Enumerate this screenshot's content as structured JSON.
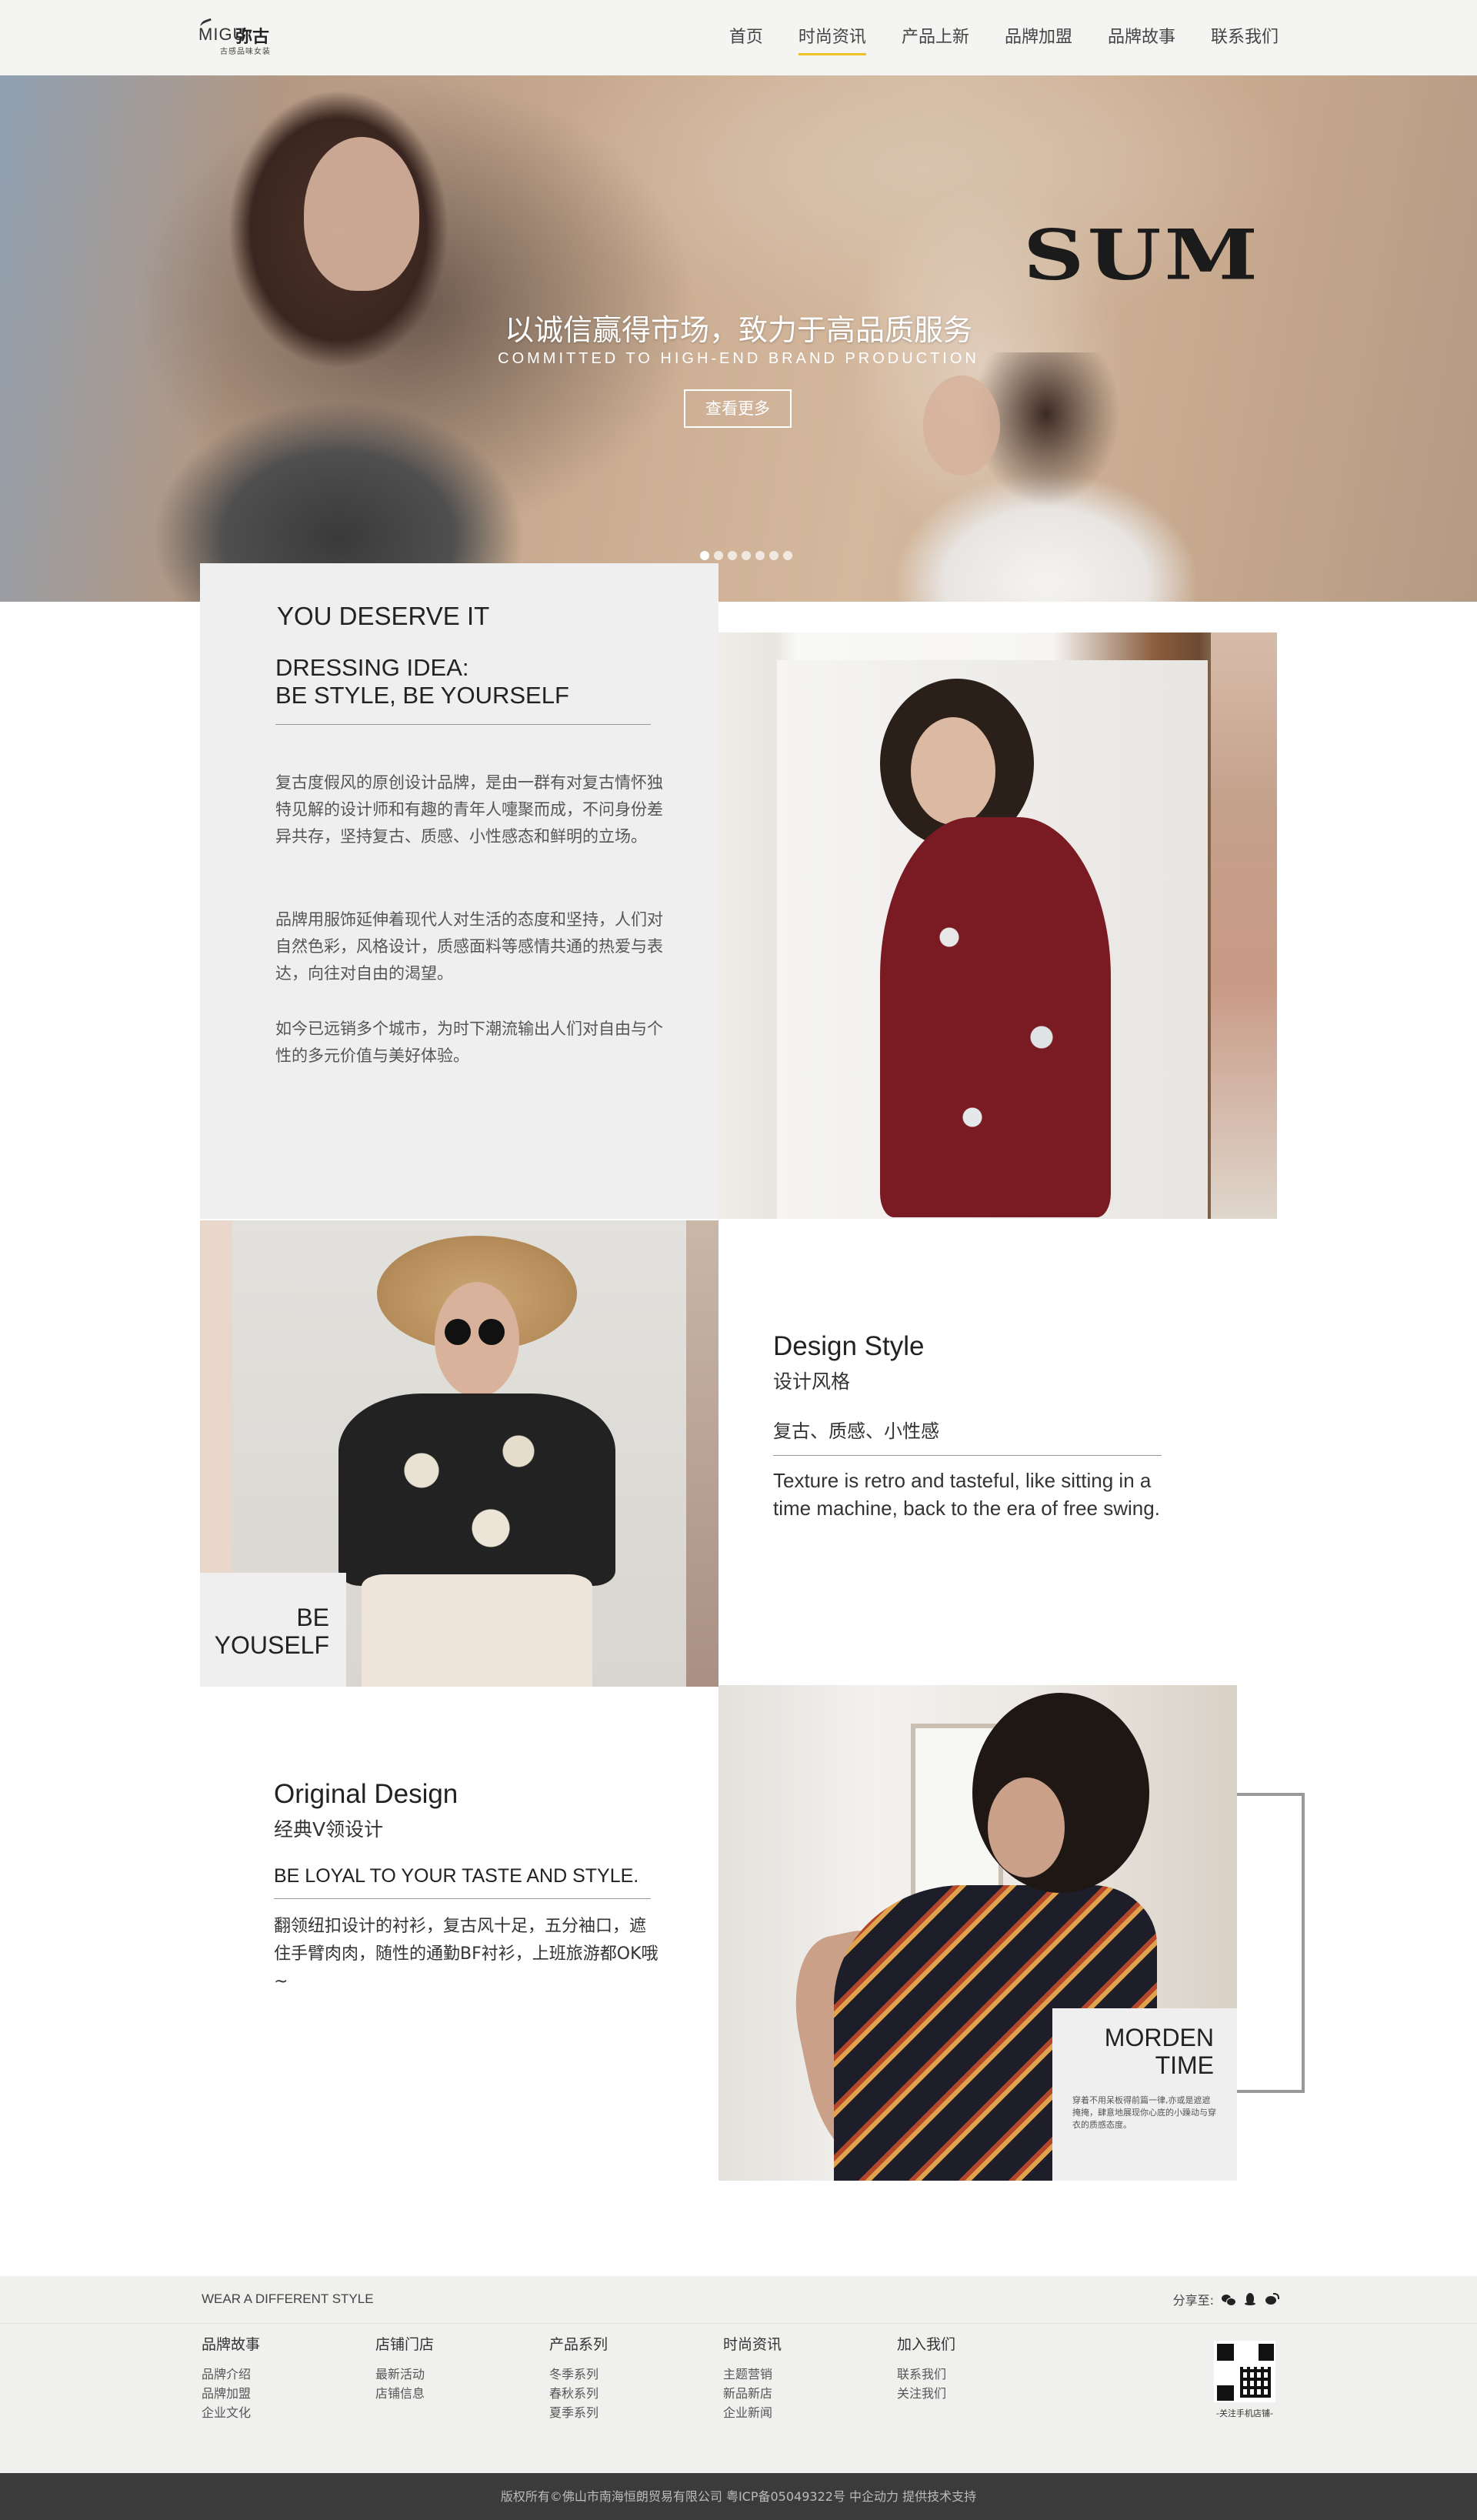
{
  "header": {
    "logo_en": "MIGU",
    "logo_cn": "弥古",
    "logo_sub": "古感品味女装",
    "nav": [
      {
        "label": "首页"
      },
      {
        "label": "时尚资讯",
        "active": true
      },
      {
        "label": "产品上新"
      },
      {
        "label": "品牌加盟"
      },
      {
        "label": "品牌故事"
      },
      {
        "label": "联系我们"
      }
    ]
  },
  "hero": {
    "brand_text": "SUM",
    "title": "以诚信赢得市场，致力于高品质服务",
    "subtitle": "COMMITTED TO HIGH-END BRAND PRODUCTION",
    "button_label": "查看更多",
    "slide_count": 7,
    "active_slide": 1
  },
  "intro": {
    "heading": "YOU DESERVE IT",
    "subheading_line1": "DRESSING IDEA:",
    "subheading_line2": "BE STYLE, BE YOURSELF",
    "paragraph1": "复古度假风的原创设计品牌，是由一群有对复古情怀独特见解的设计师和有趣的青年人嚏聚而成，不问身份差异共存，坚持复古、质感、小性感态和鲜明的立场。",
    "paragraph2": "品牌用服饰延伸着现代人对生活的态度和坚持，人们对自然色彩，风格设计，质感面料等感情共通的热爱与表达，向往对自由的渴望。",
    "paragraph3": "如今已远销多个城市，为时下潮流输出人们对自由与个性的多元价值与美好体验。"
  },
  "be_yourself": {
    "line1": "BE",
    "line2": "YOUSELF"
  },
  "design_style": {
    "heading": "Design Style",
    "subheading": "设计风格",
    "keywords": "复古、质感、小性感",
    "text": "Texture is retro and tasteful, like sitting in a time machine, back to the era of free swing."
  },
  "original_design": {
    "heading": "Original Design",
    "subheading": "经典V领设计",
    "tagline": "BE LOYAL TO YOUR TASTE AND STYLE.",
    "text": "翻领纽扣设计的衬衫，复古风十足，五分袖口，遮住手臂肉肉，随性的通勤BF衬衫，上班旅游都OK哦~"
  },
  "morden_time": {
    "line1": "MORDEN",
    "line2": "TIME",
    "text": "穿着不用呆板得前篇一律,亦或是遮遮掩掩，肆意地展现你心底的小躁动与穿衣的质感态度。"
  },
  "footer": {
    "slogan": "WEAR A DIFFERENT STYLE",
    "share_label": "分享至:",
    "columns": [
      {
        "head": "品牌故事",
        "links": [
          "品牌介绍",
          "品牌加盟",
          "企业文化"
        ]
      },
      {
        "head": "店铺门店",
        "links": [
          "最新活动",
          "店铺信息"
        ]
      },
      {
        "head": "产品系列",
        "links": [
          "冬季系列",
          "春秋系列",
          "夏季系列"
        ]
      },
      {
        "head": "时尚资讯",
        "links": [
          "主题营销",
          "新品新店",
          "企业新闻"
        ]
      },
      {
        "head": "加入我们",
        "links": [
          "联系我们",
          "关注我们"
        ]
      }
    ],
    "qr_label": "-关注手机店铺-",
    "copyright": "版权所有©佛山市南海恒朗贸易有限公司    粤ICP备05049322号    中企动力 提供技术支持"
  }
}
